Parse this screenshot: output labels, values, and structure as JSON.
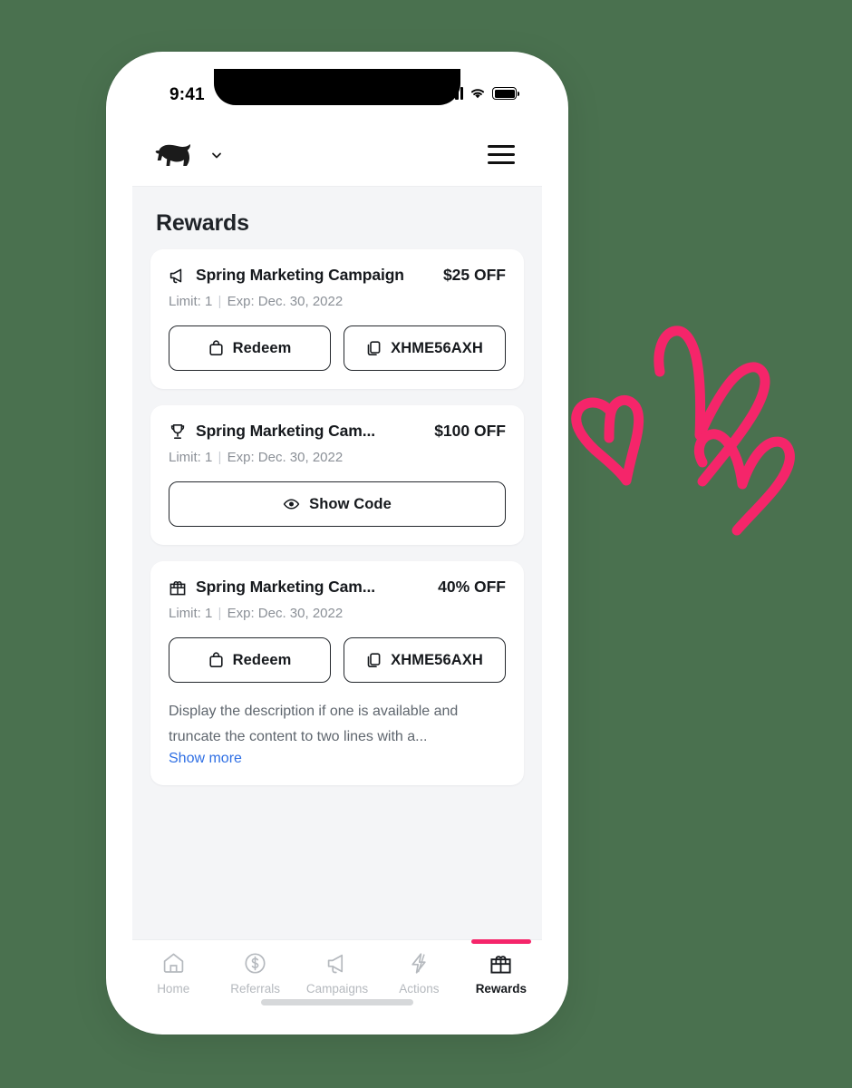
{
  "status_bar": {
    "time": "9:41",
    "signal_icon": "signal-bars-icon",
    "wifi_icon": "wifi-icon",
    "battery_icon": "battery-full-icon"
  },
  "header": {
    "logo_icon": "tapir-logo-icon",
    "dropdown_icon": "chevron-down-icon",
    "menu_icon": "hamburger-menu-icon"
  },
  "page": {
    "title": "Rewards",
    "background": "#f4f5f7"
  },
  "rewards": [
    {
      "icon": "megaphone-icon",
      "title": "Spring Marketing Campaign",
      "amount": "$25 OFF",
      "limit_label": "Limit: 1",
      "separator": "|",
      "expiry_label": "Exp: Dec. 30, 2022",
      "buttons": [
        {
          "icon": "shopping-bag-icon",
          "label": "Redeem"
        },
        {
          "icon": "copy-icon",
          "label": "XHME56AXH"
        }
      ],
      "description": null,
      "show_more_label": null
    },
    {
      "icon": "trophy-icon",
      "title": "Spring Marketing Cam...",
      "amount": "$100 OFF",
      "limit_label": "Limit: 1",
      "separator": "|",
      "expiry_label": "Exp: Dec. 30, 2022",
      "buttons": [
        {
          "icon": "eye-icon",
          "label": "Show Code"
        }
      ],
      "description": null,
      "show_more_label": null
    },
    {
      "icon": "gift-icon",
      "title": "Spring Marketing Cam...",
      "amount": "40% OFF",
      "limit_label": "Limit: 1",
      "separator": "|",
      "expiry_label": "Exp: Dec. 30, 2022",
      "buttons": [
        {
          "icon": "shopping-bag-icon",
          "label": "Redeem"
        },
        {
          "icon": "copy-icon",
          "label": "XHME56AXH"
        }
      ],
      "description": "Display the description if one is available and truncate the content to two lines with a...",
      "show_more_label": "Show more"
    }
  ],
  "tab_bar": {
    "active_accent_color": "#f5256a",
    "items": [
      {
        "icon": "home-icon",
        "label": "Home",
        "active": false
      },
      {
        "icon": "dollar-circle-icon",
        "label": "Referrals",
        "active": false
      },
      {
        "icon": "megaphone-icon",
        "label": "Campaigns",
        "active": false
      },
      {
        "icon": "lightning-bolt-icon",
        "label": "Actions",
        "active": false
      },
      {
        "icon": "gift-icon",
        "label": "Rewards",
        "active": true
      }
    ]
  },
  "decoration": {
    "hearts_icon": "hand-drawn-hearts-icon",
    "hearts_color": "#f5256a",
    "count": 3
  },
  "canvas": {
    "background_color": "#4a714f"
  }
}
